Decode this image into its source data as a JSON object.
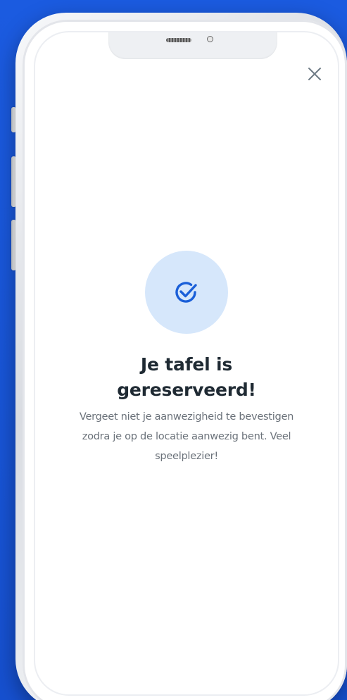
{
  "screen": {
    "close_icon": "close-icon",
    "success_icon": "check-circle-icon",
    "title": "Je tafel is gereserveerd!",
    "message": "Vergeet niet je aanwezigheid te bevestigen zodra je op de locatie aanwezig bent. Veel speelplezier!"
  },
  "colors": {
    "background": "#1650cf",
    "icon_circle": "#d6e7fb",
    "icon_stroke": "#1a5fd8",
    "title": "#1f2a33",
    "message": "#6b727a",
    "close_icon": "#6f7c86"
  }
}
